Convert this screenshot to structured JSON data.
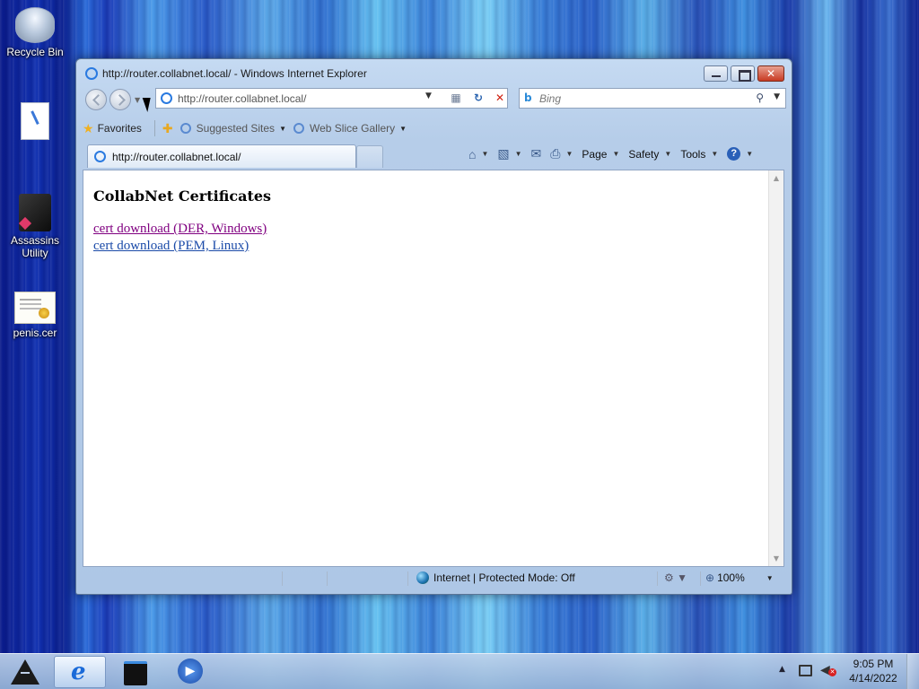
{
  "desktop": {
    "icons": [
      {
        "label": "Recycle Bin"
      },
      {
        "label": ""
      },
      {
        "label": "Assassins Utility"
      },
      {
        "label": "penis.cer"
      }
    ]
  },
  "window": {
    "title": "http://router.collabnet.local/ - Windows Internet Explorer"
  },
  "address_bar": {
    "url": "http://router.collabnet.local/"
  },
  "search": {
    "placeholder": "Bing"
  },
  "favorites_bar": {
    "favorites_label": "Favorites",
    "items": [
      {
        "label": "Suggested Sites"
      },
      {
        "label": "Web Slice Gallery"
      }
    ]
  },
  "tab": {
    "title": "http://router.collabnet.local/"
  },
  "command_bar": {
    "page_label": "Page",
    "safety_label": "Safety",
    "tools_label": "Tools"
  },
  "page": {
    "heading": "CollabNet Certificates",
    "links": [
      {
        "label": "cert download (DER, Windows)"
      },
      {
        "label": "cert download (PEM, Linux)"
      }
    ]
  },
  "status_bar": {
    "zone": "Internet | Protected Mode: Off",
    "zoom": "100%"
  },
  "taskbar": {
    "time": "9:05 PM",
    "date": "4/14/2022"
  }
}
